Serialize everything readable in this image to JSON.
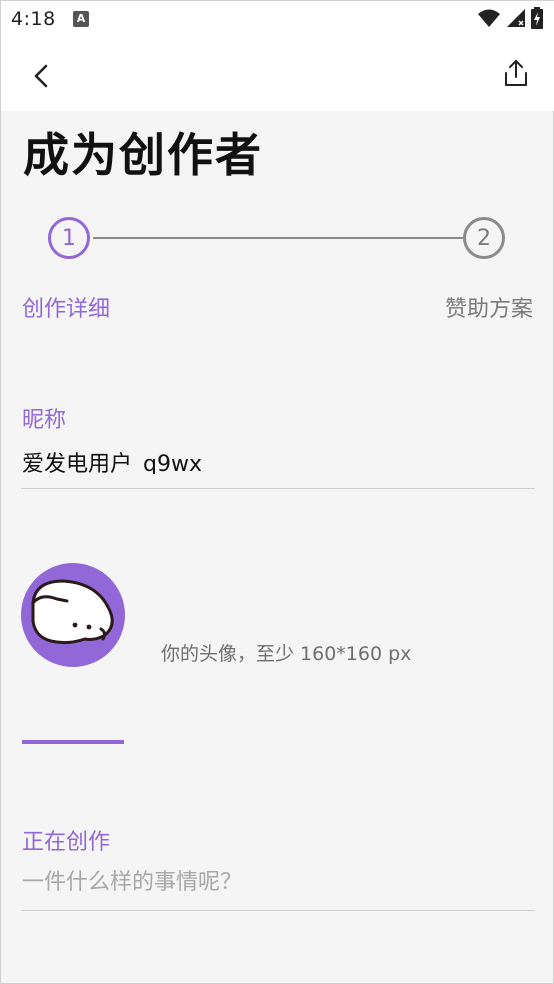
{
  "status_bar": {
    "time": "4:18",
    "notification_icon": "A",
    "icons": [
      "wifi-icon",
      "signal-icon",
      "battery-icon"
    ]
  },
  "app_bar": {
    "back_icon": "chevron-left-icon",
    "share_icon": "share-icon"
  },
  "page": {
    "title": "成为创作者"
  },
  "stepper": {
    "steps": [
      {
        "number": "1",
        "label": "创作详细",
        "active": true
      },
      {
        "number": "2",
        "label": "赞助方案",
        "active": false
      }
    ]
  },
  "form": {
    "nickname": {
      "label": "昵称",
      "value": "爱发电用户_q9wx"
    },
    "avatar": {
      "hint": "你的头像，至少 160*160 px"
    },
    "creating": {
      "label": "正在创作",
      "value": "",
      "placeholder": "一件什么样的事情呢？"
    }
  },
  "colors": {
    "accent": "#9267d8",
    "inactive": "#8a8a8a",
    "background": "#f5f5f5"
  }
}
